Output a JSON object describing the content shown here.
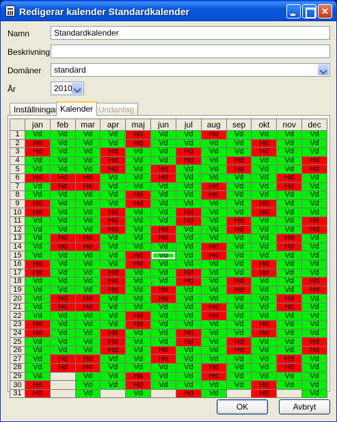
{
  "window": {
    "title": "Redigerar kalender Standardkalender"
  },
  "form": {
    "name_label": "Namn",
    "name_value": "Standardkalender",
    "desc_label": "Beskrivning",
    "desc_value": "",
    "domain_label": "Domäner",
    "domain_value": "standard",
    "year_label": "År",
    "year_value": "2010"
  },
  "tabs": [
    "Inställningar",
    "Kalender",
    "Undantag"
  ],
  "calendar": {
    "months": [
      "jan",
      "feb",
      "mar",
      "apr",
      "maj",
      "jun",
      "jul",
      "aug",
      "sep",
      "okt",
      "nov",
      "dec"
    ],
    "rows": [
      [
        "Vd",
        "Vd",
        "Vd",
        "Vd",
        "Hd",
        "Vd",
        "Vd",
        "Hd",
        "Vd",
        "Vd",
        "Vd",
        "Vd"
      ],
      [
        "Hd",
        "Vd",
        "Vd",
        "Vd",
        "Hd",
        "Vd",
        "Vd",
        "Vd",
        "Vd",
        "Hd",
        "Vd",
        "Vd"
      ],
      [
        "Hd",
        "Vd",
        "Vd",
        "Hd",
        "Vd",
        "Vd",
        "Hd",
        "Vd",
        "Vd",
        "Hd",
        "Vd",
        "Vd"
      ],
      [
        "Vd",
        "Vd",
        "Vd",
        "Hd",
        "Vd",
        "Vd",
        "Hd",
        "Vd",
        "Hd",
        "Vd",
        "Vd",
        "Hd"
      ],
      [
        "Vd",
        "Vd",
        "Vd",
        "Hd",
        "Vd",
        "Hd",
        "Vd",
        "Vd",
        "Hd",
        "Vd",
        "Vd",
        "Hd"
      ],
      [
        "Hd",
        "Hd",
        "Hd",
        "Vd",
        "Vd",
        "Hd",
        "Vd",
        "Vd",
        "Vd",
        "Vd",
        "Hd",
        "Vd"
      ],
      [
        "Vd",
        "Hd",
        "Hd",
        "Vd",
        "Vd",
        "Vd",
        "Vd",
        "Hd",
        "Vd",
        "Vd",
        "Hd",
        "Vd"
      ],
      [
        "Vd",
        "Vd",
        "Vd",
        "Vd",
        "Hd",
        "Vd",
        "Vd",
        "Hd",
        "Vd",
        "Vd",
        "Vd",
        "Vd"
      ],
      [
        "Hd",
        "Vd",
        "Vd",
        "Vd",
        "Hd",
        "Vd",
        "Vd",
        "Vd",
        "Vd",
        "Hd",
        "Vd",
        "Vd"
      ],
      [
        "Hd",
        "Vd",
        "Vd",
        "Hd",
        "Vd",
        "Vd",
        "Hd",
        "Vd",
        "Vd",
        "Hd",
        "Vd",
        "Vd"
      ],
      [
        "Vd",
        "Vd",
        "Vd",
        "Hd",
        "Vd",
        "Vd",
        "Hd",
        "Vd",
        "Hd",
        "Vd",
        "Vd",
        "Hd"
      ],
      [
        "Vd",
        "Vd",
        "Vd",
        "Hd",
        "Vd",
        "Hd",
        "Vd",
        "Vd",
        "Hd",
        "Vd",
        "Vd",
        "Hd"
      ],
      [
        "Vd",
        "Hd",
        "Hd",
        "Vd",
        "Vd",
        "Hd",
        "Vd",
        "Vd",
        "Vd",
        "Vd",
        "Hd",
        "Vd"
      ],
      [
        "Vd",
        "Hd",
        "Hd",
        "Vd",
        "Vd",
        "Vd",
        "Vd",
        "Hd",
        "Vd",
        "Vd",
        "Hd",
        "Vd"
      ],
      [
        "Vd",
        "Vd",
        "Vd",
        "Vd",
        "Hd",
        "Vd",
        "Vd",
        "Hd",
        "Vd",
        "Vd",
        "Vd",
        "Vd"
      ],
      [
        "Hd",
        "Vd",
        "Vd",
        "Vd",
        "Hd",
        "Vd",
        "Vd",
        "Vd",
        "Vd",
        "Hd",
        "Vd",
        "Vd"
      ],
      [
        "Hd",
        "Vd",
        "Vd",
        "Hd",
        "Vd",
        "Vd",
        "Hd",
        "Vd",
        "Vd",
        "Hd",
        "Vd",
        "Vd"
      ],
      [
        "Vd",
        "Vd",
        "Vd",
        "Hd",
        "Vd",
        "Vd",
        "Hd",
        "Vd",
        "Hd",
        "Vd",
        "Vd",
        "Hd"
      ],
      [
        "Vd",
        "Vd",
        "Vd",
        "Hd",
        "Vd",
        "Hd",
        "Vd",
        "Vd",
        "Hd",
        "Vd",
        "Vd",
        "Hd"
      ],
      [
        "Vd",
        "Hd",
        "Hd",
        "Vd",
        "Vd",
        "Hd",
        "Vd",
        "Vd",
        "Vd",
        "Vd",
        "Hd",
        "Vd"
      ],
      [
        "Vd",
        "Hd",
        "Hd",
        "Vd",
        "Vd",
        "Vd",
        "Vd",
        "Hd",
        "Vd",
        "Vd",
        "Hd",
        "Vd"
      ],
      [
        "Vd",
        "Vd",
        "Vd",
        "Vd",
        "Hd",
        "Vd",
        "Vd",
        "Hd",
        "Vd",
        "Vd",
        "Vd",
        "Vd"
      ],
      [
        "Hd",
        "Vd",
        "Vd",
        "Vd",
        "Hd",
        "Vd",
        "Vd",
        "Vd",
        "Vd",
        "Hd",
        "Vd",
        "Vd"
      ],
      [
        "Hd",
        "Vd",
        "Vd",
        "Hd",
        "Vd",
        "Vd",
        "Hd",
        "Vd",
        "Vd",
        "Hd",
        "Vd",
        "Vd"
      ],
      [
        "Vd",
        "Vd",
        "Vd",
        "Hd",
        "Vd",
        "Vd",
        "Hd",
        "Vd",
        "Hd",
        "Vd",
        "Vd",
        "Hd"
      ],
      [
        "Vd",
        "Vd",
        "Vd",
        "Hd",
        "Vd",
        "Hd",
        "Vd",
        "Vd",
        "Hd",
        "Vd",
        "Vd",
        "Hd"
      ],
      [
        "Vd",
        "Hd",
        "Hd",
        "Vd",
        "Vd",
        "Hd",
        "Vd",
        "Vd",
        "Vd",
        "Vd",
        "Hd",
        "Vd"
      ],
      [
        "Vd",
        "Hd",
        "Hd",
        "Vd",
        "Vd",
        "Vd",
        "Vd",
        "Hd",
        "Vd",
        "Vd",
        "Hd",
        "Vd"
      ],
      [
        "Vd",
        "",
        "Vd",
        "Vd",
        "Hd",
        "Vd",
        "Vd",
        "Hd",
        "Vd",
        "Vd",
        "Vd",
        "Vd"
      ],
      [
        "Hd",
        "",
        "Vd",
        "Vd",
        "Hd",
        "Vd",
        "Vd",
        "Vd",
        "Vd",
        "Hd",
        "Vd",
        "Vd"
      ],
      [
        "Hd",
        "",
        "Vd",
        "",
        "Vd",
        "",
        "Hd",
        "Vd",
        "",
        "Hd",
        "",
        "Vd"
      ]
    ],
    "selected": {
      "row": 15,
      "month": "jun"
    }
  },
  "buttons": {
    "ok": "OK",
    "cancel": "Avbryt"
  }
}
